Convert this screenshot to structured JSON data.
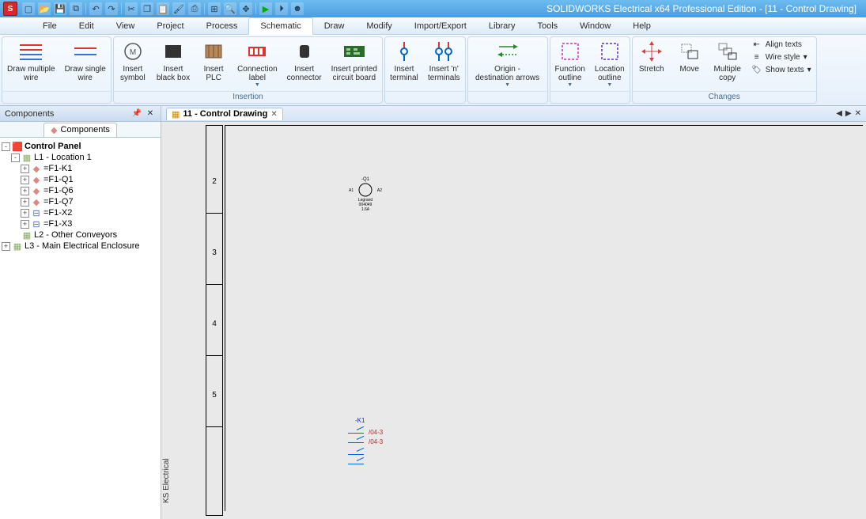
{
  "title": "SOLIDWORKS Electrical x64 Professional Edition - [11 - Control Drawing]",
  "qat": [
    "new",
    "open",
    "save",
    "saveall",
    "",
    "undo",
    "redo",
    "",
    "cut",
    "copy",
    "paste",
    "copyfmt",
    "print",
    "",
    "zoomext",
    "zoomwin",
    "pan",
    "",
    "run",
    "play",
    "face"
  ],
  "menu": [
    "File",
    "Edit",
    "View",
    "Project",
    "Process",
    "Schematic",
    "Draw",
    "Modify",
    "Import/Export",
    "Library",
    "Tools",
    "Window",
    "Help"
  ],
  "menu_active": 5,
  "ribbon": {
    "g1": {
      "btns": [
        {
          "lbl": "Draw multiple\nwire"
        },
        {
          "lbl": "Draw single\nwire"
        }
      ]
    },
    "g2": {
      "label": "Insertion",
      "btns": [
        {
          "lbl": "Insert\nsymbol"
        },
        {
          "lbl": "Insert\nblack box"
        },
        {
          "lbl": "Insert\nPLC"
        },
        {
          "lbl": "Connection\nlabel",
          "dd": true
        },
        {
          "lbl": "Insert\nconnector"
        },
        {
          "lbl": "Insert printed\ncircuit board"
        }
      ]
    },
    "g3": {
      "btns": [
        {
          "lbl": "Insert\nterminal"
        },
        {
          "lbl": "Insert 'n'\nterminals"
        }
      ]
    },
    "g4": {
      "btns": [
        {
          "lbl": "Origin -\ndestination arrows",
          "dd": true
        }
      ]
    },
    "g5": {
      "btns": [
        {
          "lbl": "Function\noutline",
          "dd": true
        },
        {
          "lbl": "Location\noutline",
          "dd": true
        }
      ]
    },
    "g6": {
      "label": "Changes",
      "btns": [
        {
          "lbl": "Stretch"
        },
        {
          "lbl": "Move"
        },
        {
          "lbl": "Multiple\ncopy"
        }
      ],
      "stack": [
        {
          "lbl": "Align texts"
        },
        {
          "lbl": "Wire style",
          "dd": true
        },
        {
          "lbl": "Show texts",
          "dd": true
        }
      ]
    }
  },
  "panel": {
    "title": "Components",
    "tab": "Components",
    "tree": [
      {
        "ind": 0,
        "exp": "-",
        "ico": "proj",
        "lbl": "Control Panel",
        "bold": true
      },
      {
        "ind": 1,
        "exp": "-",
        "ico": "loc",
        "lbl": "L1 - Location 1"
      },
      {
        "ind": 2,
        "exp": "+",
        "ico": "comp",
        "lbl": "=F1-K1"
      },
      {
        "ind": 2,
        "exp": "+",
        "ico": "comp",
        "lbl": "=F1-Q1"
      },
      {
        "ind": 2,
        "exp": "+",
        "ico": "comp",
        "lbl": "=F1-Q6"
      },
      {
        "ind": 2,
        "exp": "+",
        "ico": "comp",
        "lbl": "=F1-Q7"
      },
      {
        "ind": 2,
        "exp": "+",
        "ico": "term",
        "lbl": "=F1-X2"
      },
      {
        "ind": 2,
        "exp": "+",
        "ico": "term",
        "lbl": "=F1-X3"
      },
      {
        "ind": 1,
        "exp": " ",
        "ico": "loc",
        "lbl": "L2 - Other Conveyors"
      },
      {
        "ind": 0,
        "exp": "+",
        "ico": "loc",
        "lbl": "L3 - Main Electrical Enclosure"
      }
    ]
  },
  "doctab": {
    "label": "11 - Control Drawing"
  },
  "canvas": {
    "rows": [
      "2",
      "3",
      "4",
      "5"
    ],
    "k1": "-K1",
    "xref1": "/04-3",
    "xref2": "/04-3",
    "symbol_text": "Legrand\n004049\n1.6A",
    "symbol_tag": "-Q1",
    "symbol_a1": "A1",
    "symbol_a2": "A2",
    "watermark": "KS Electrical"
  }
}
